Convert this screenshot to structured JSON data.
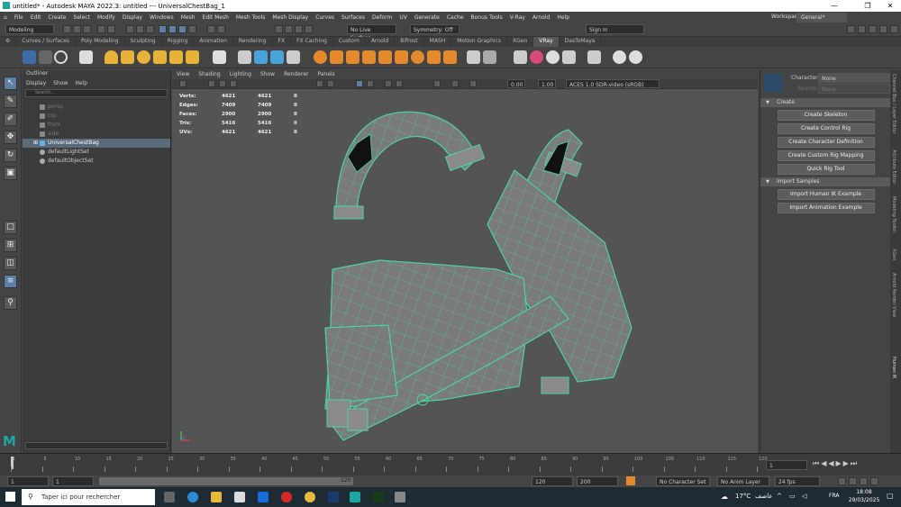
{
  "window": {
    "title": "untitled* - Autodesk MAYA 2022.3: untitled   ---   UniversalChestBag_1",
    "minimize": "—",
    "maximize": "❐",
    "close": "✕"
  },
  "menus": [
    "File",
    "Edit",
    "Create",
    "Select",
    "Modify",
    "Display",
    "Windows",
    "Mesh",
    "Edit Mesh",
    "Mesh Tools",
    "Mesh Display",
    "Curves",
    "Surfaces",
    "Deform",
    "UV",
    "Generate",
    "Cache",
    "Bonus Tools",
    "V-Ray",
    "Arnold",
    "Help"
  ],
  "workspace": {
    "label": "Workspace:",
    "value": "General*"
  },
  "status": {
    "mode": "Modeling",
    "live_surface": "No Live Surface",
    "symmetry": "Symmetry: Off",
    "sign_in": "Sign In"
  },
  "shelf_tabs": [
    "Curves / Surfaces",
    "Poly Modeling",
    "Sculpting",
    "Rigging",
    "Animation",
    "Rendering",
    "FX",
    "FX Caching",
    "Custom",
    "Arnold",
    "Bifrost",
    "MASH",
    "Motion Graphics",
    "XGen",
    "VRay",
    "DasToMaya"
  ],
  "shelf_active": "VRay",
  "outliner": {
    "title": "Outliner",
    "menu": [
      "Display",
      "Show",
      "Help"
    ],
    "search_placeholder": "Search...",
    "items": [
      {
        "label": "persp",
        "dim": true
      },
      {
        "label": "top",
        "dim": true
      },
      {
        "label": "front",
        "dim": true
      },
      {
        "label": "side",
        "dim": true
      },
      {
        "label": "UniversalChestBag",
        "selected": true
      },
      {
        "label": "defaultLightSet"
      },
      {
        "label": "defaultObjectSet"
      }
    ]
  },
  "viewport": {
    "menu": [
      "View",
      "Shading",
      "Lighting",
      "Show",
      "Renderer",
      "Panels"
    ],
    "exposure": "0.00",
    "gamma": "1.00",
    "colorspace": "ACES 1.0 SDR-video (sRGB)",
    "hud": [
      {
        "label": "Verts:",
        "a": "4621",
        "b": "4621",
        "c": "0"
      },
      {
        "label": "Edges:",
        "a": "7409",
        "b": "7409",
        "c": "0"
      },
      {
        "label": "Faces:",
        "a": "2900",
        "b": "2900",
        "c": "0"
      },
      {
        "label": "Tris:",
        "a": "5416",
        "b": "5416",
        "c": "0"
      },
      {
        "label": "UVs:",
        "a": "4621",
        "b": "4621",
        "c": "0"
      }
    ]
  },
  "humanik": {
    "character_label": "Character:",
    "character_value": "None",
    "source_label": "Source:",
    "source_value": "None",
    "sections": [
      {
        "title": "Create",
        "buttons": [
          "Create Skeleton",
          "Create Control Rig",
          "Create Character Definition",
          "Create Custom Rig Mapping",
          "Quick Rig Tool"
        ]
      },
      {
        "title": "Import Samples",
        "buttons": [
          "Import Human IK Example",
          "Import Animation Example"
        ]
      }
    ]
  },
  "side_tabs": [
    "Channel Box / Layer Editor",
    "Attribute Editor",
    "Modeling Toolkit",
    "XGen",
    "Arnold Render View",
    "Human IK"
  ],
  "timeline": {
    "ticks": [
      "1",
      "5",
      "10",
      "15",
      "20",
      "25",
      "30",
      "35",
      "40",
      "45",
      "50",
      "55",
      "60",
      "65",
      "70",
      "75",
      "80",
      "85",
      "90",
      "95",
      "100",
      "105",
      "110",
      "115",
      "120"
    ],
    "current_frame": "1"
  },
  "range": {
    "start": "1",
    "inner_start": "1",
    "inner_end": "120",
    "slider_value": "120",
    "end": "120",
    "max": "200",
    "character_set": "No Character Set",
    "anim_layer": "No Anim Layer",
    "fps": "24 fps"
  },
  "taskbar": {
    "search": "Taper ici pour rechercher",
    "weather": "17°C",
    "weather_text": "عاصف",
    "lang": "FRA",
    "time": "18:08",
    "date": "29/03/2025"
  },
  "colors": {
    "wire": "#4dd6a0",
    "mesh": "#7a7a7a",
    "viewport_bg": "#545454"
  }
}
